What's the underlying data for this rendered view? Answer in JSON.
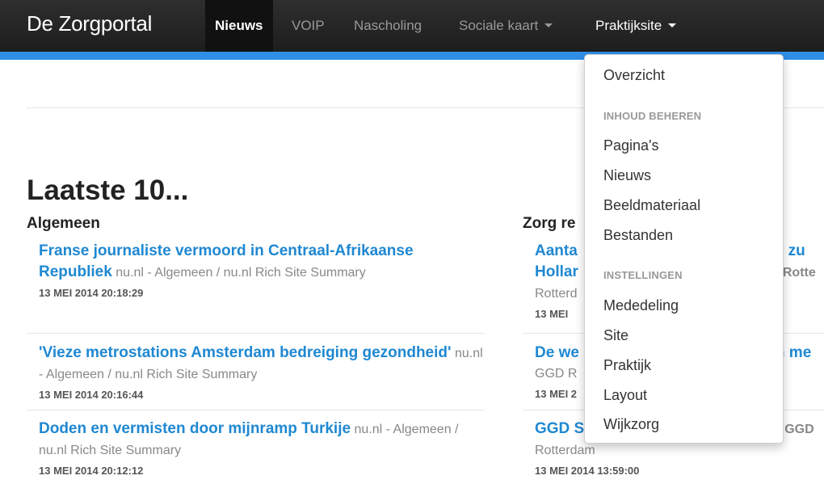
{
  "navbar": {
    "brand": "De Zorgportal",
    "items": [
      {
        "label": "Nieuws"
      },
      {
        "label": "VOIP"
      },
      {
        "label": "Nascholing"
      },
      {
        "label": "Sociale kaart"
      },
      {
        "label": "Praktijksite"
      }
    ]
  },
  "main": {
    "heading": "Laatste 10...",
    "left_column": {
      "title": "Algemeen",
      "items": [
        {
          "title": "Franse journaliste vermoord in Centraal-Afrikaanse Republiek",
          "source": "nu.nl - Algemeen / nu.nl Rich Site Summary",
          "date": "13 MEI 2014 20:18:29"
        },
        {
          "title": "'Vieze metrostations Amsterdam bedreiging gezondheid'",
          "source": "nu.nl - Algemeen / nu.nl Rich Site Summary",
          "date": "13 MEI 2014 20:16:44"
        },
        {
          "title": "Doden en vermisten door mijnramp Turkije",
          "source": "nu.nl - Algemeen / nu.nl Rich Site Summary",
          "date": "13 MEI 2014 20:12:12"
        }
      ]
    },
    "right_column": {
      "title": "Zorg re",
      "items": [
        {
          "title_a": "Aanta",
          "title_b": "gio zu",
          "title_c": "Hollar",
          "source_a": "D Rotte",
          "source_b": "Rotterd",
          "date": "13 MEI"
        },
        {
          "title_a": "De we",
          "title_b": "n me",
          "source_a": "GGD R",
          "date": "13 MEI 2"
        },
        {
          "title_a": "GGD S",
          "source_a": "GGD",
          "source_b": "Rotterdam",
          "date": "13 MEI 2014 13:59:00"
        }
      ]
    }
  },
  "dropdown": {
    "overview": "Overzicht",
    "header_content": "INHOUD BEHEREN",
    "content_items": [
      "Pagina's",
      "Nieuws",
      "Beeldmateriaal",
      "Bestanden"
    ],
    "header_settings": "INSTELLINGEN",
    "settings_items": [
      "Mededeling",
      "Site",
      "Praktijk",
      "Layout",
      "Wijkzorg"
    ]
  },
  "colors": {
    "navbar": "#222222",
    "accent": "#2f8fe6",
    "link": "#1f88d2"
  }
}
